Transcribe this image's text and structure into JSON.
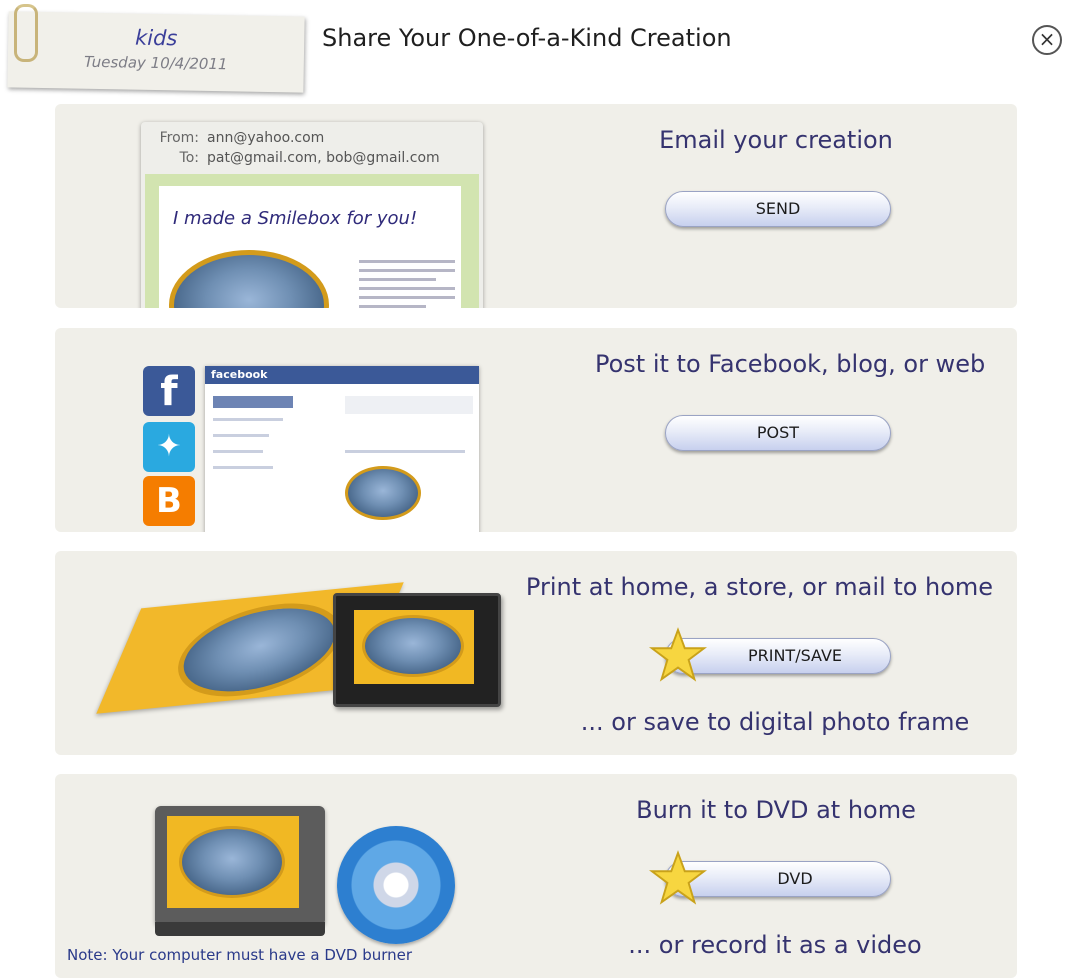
{
  "header": {
    "note_name": "kids",
    "note_date": "Tuesday 10/4/2011",
    "title": "Share Your One-of-a-Kind Creation",
    "close_symbol": "×"
  },
  "email": {
    "heading": "Email your creation",
    "button": "SEND",
    "preview": {
      "from_label": "From:",
      "from": "ann@yahoo.com",
      "to_label": "To:",
      "to": "pat@gmail.com, bob@gmail.com",
      "card_text": "I made a Smilebox for you!"
    }
  },
  "post": {
    "heading": "Post it to Facebook, blog, or web",
    "button": "POST",
    "preview": {
      "facebook_brand": "facebook",
      "icons": [
        "facebook-icon",
        "twitter-icon",
        "blogger-icon"
      ]
    }
  },
  "print": {
    "heading": "Print at home, a store, or mail to home",
    "button": "PRINT/SAVE",
    "sub": "... or save to digital photo frame"
  },
  "dvd": {
    "heading": "Burn it to DVD at home",
    "button": "DVD",
    "sub": "... or record it as a video",
    "note": "Note: Your computer must have a DVD burner"
  },
  "colors": {
    "panel_bg": "#f0efe9",
    "heading": "#35336f",
    "button_gradient_end": "#c7d0ee"
  }
}
